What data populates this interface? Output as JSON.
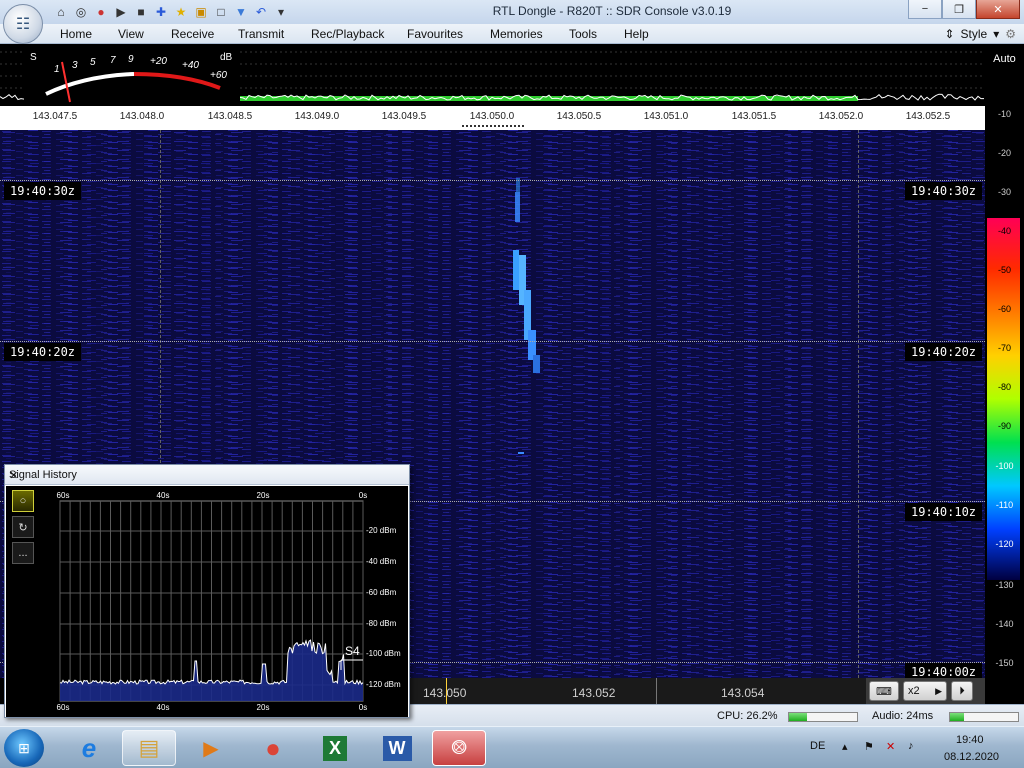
{
  "window": {
    "title": "RTL Dongle - R820T :: SDR Console v3.0.19",
    "minimize_glyph": "−",
    "maximize_glyph": "❐",
    "close_glyph": "✕"
  },
  "quick_access": {
    "icons": [
      "home-icon",
      "lifebuoy-icon",
      "record-icon",
      "play-icon",
      "stop-icon",
      "plus-icon",
      "star-icon",
      "lock-icon",
      "camera-icon",
      "drop-icon",
      "undo-icon",
      "dropdown-icon"
    ],
    "glyphs": [
      "⌂",
      "◎",
      "●",
      "▶",
      "■",
      "✚",
      "★",
      "▣",
      "□",
      "▼",
      "↶",
      "▾"
    ]
  },
  "menu": {
    "items": [
      "Home",
      "View",
      "Receive",
      "Transmit",
      "Rec/Playback",
      "Favourites",
      "Memories",
      "Tools",
      "Help"
    ],
    "style_label": "Style"
  },
  "smeter": {
    "s_label": "S",
    "db_label": "dB",
    "scale": [
      "1",
      "3",
      "5",
      "7",
      "9",
      "+20",
      "+40",
      "+60"
    ]
  },
  "frequency_scale": {
    "labels": [
      "143.047.5",
      "143.048.0",
      "143.048.5",
      "143.049.0",
      "143.049.5",
      "143.050.0",
      "143.050.5",
      "143.051.0",
      "143.051.5",
      "143.052.0",
      "143.052.5"
    ]
  },
  "right_scale": {
    "auto_label": "Auto",
    "top_labels": [
      "-10",
      "-20",
      "-30"
    ],
    "colorbar_labels": [
      "-40",
      "-50",
      "-60",
      "-70",
      "-80",
      "-90",
      "-100",
      "-110",
      "-120"
    ],
    "bottom_labels": [
      "-130",
      "-140",
      "-150"
    ]
  },
  "waterfall": {
    "time_labels": [
      "19:40:30z",
      "19:40:20z",
      "19:40:10z",
      "19:40:00z"
    ]
  },
  "bottom_bar": {
    "freqs": [
      "143.050",
      "143.052",
      "143.054"
    ],
    "zoom_label": "x2",
    "keyboard_icon": "keyboard-icon",
    "next_icon": "triangle-right-icon",
    "play_icon": "play-circle-icon"
  },
  "status": {
    "cpu": "CPU: 26.2%",
    "cpu_level": 0.262,
    "audio": "Audio: 24ms",
    "audio_level": 0.2
  },
  "signal_history": {
    "title": "Signal History",
    "close_glyph": "✕",
    "x_labels_top": [
      "60s",
      "40s",
      "20s",
      "0s"
    ],
    "x_labels_bottom": [
      "60s",
      "40s",
      "20s",
      "0s"
    ],
    "y_labels": [
      "-20 dBm",
      "-40 dBm",
      "-60 dBm",
      "-80 dBm",
      "-100 dBm",
      "-120 dBm"
    ],
    "marker_label": "S4",
    "tools": [
      "○",
      "↻",
      "..."
    ]
  },
  "taskbar": {
    "apps": [
      "ie-icon",
      "explorer-icon",
      "media-player-icon",
      "chrome-icon",
      "excel-icon",
      "word-icon",
      "sdr-console-icon"
    ],
    "app_glyphs": [
      "e",
      "▤",
      "▶",
      "●",
      "X",
      "W",
      "⨷"
    ],
    "language": "DE",
    "time": "19:40",
    "date": "08.12.2020",
    "tray_glyphs": [
      "▴",
      "⚑",
      "✕",
      "♪"
    ]
  },
  "colors": {
    "waterfall_bg": "#0a0a3a",
    "signal": "#2aa0ff",
    "spectrum_trace": "#ffffff",
    "spectrum_fill": "#2ecc2e"
  }
}
